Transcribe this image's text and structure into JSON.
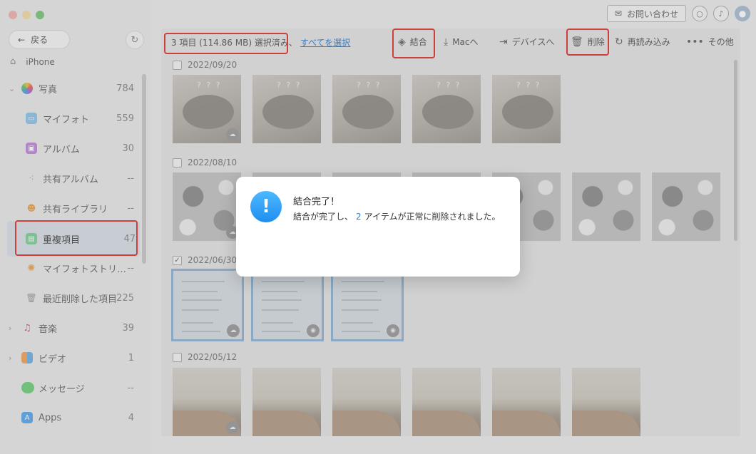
{
  "window": {
    "controls": [
      "close",
      "minimize",
      "maximize"
    ]
  },
  "sidebar": {
    "back_label": "戻る",
    "device_name": "iPhone",
    "items": [
      {
        "label": "写真",
        "count": "784",
        "expandable": true,
        "expanded": true,
        "icon": "photos-icon"
      },
      {
        "label": "マイフォト",
        "count": "559",
        "icon": "my-photos-icon"
      },
      {
        "label": "アルバム",
        "count": "30",
        "icon": "album-icon"
      },
      {
        "label": "共有アルバム",
        "count": "--",
        "icon": "shared-album-icon"
      },
      {
        "label": "共有ライブラリ",
        "count": "--",
        "icon": "shared-library-icon"
      },
      {
        "label": "重複項目",
        "count": "47",
        "icon": "duplicates-icon",
        "active": true
      },
      {
        "label": "マイフォトストリ…",
        "count": "--",
        "icon": "photo-stream-icon"
      },
      {
        "label": "最近削除した項目",
        "count": "225",
        "icon": "trash-icon"
      },
      {
        "label": "音楽",
        "count": "39",
        "expandable": true,
        "icon": "music-icon"
      },
      {
        "label": "ビデオ",
        "count": "1",
        "expandable": true,
        "icon": "video-icon"
      },
      {
        "label": "メッセージ",
        "count": "--",
        "icon": "messages-icon"
      },
      {
        "label": "Apps",
        "count": "4",
        "icon": "apps-icon"
      }
    ]
  },
  "topbar": {
    "contact_label": "お問い合わせ"
  },
  "toolbar": {
    "selection_info": "3 項目 (114.86 MB) 選択済み、",
    "select_all": "すべてを選択",
    "merge": "結合",
    "to_mac": "Macへ",
    "to_device": "デバイスへ",
    "delete": "削除",
    "reload": "再読み込み",
    "more": "その他"
  },
  "groups": [
    {
      "date": "2022/09/20",
      "checked": false,
      "count": 5,
      "kind": "cat"
    },
    {
      "date": "2022/08/10",
      "checked": false,
      "count": 7,
      "kind": "bear"
    },
    {
      "date": "2022/06/30",
      "checked": true,
      "count": 3,
      "kind": "shot"
    },
    {
      "date": "2022/05/12",
      "checked": false,
      "count": 6,
      "kind": "room"
    }
  ],
  "dialog": {
    "title": "結合完了！",
    "msg_pre": "結合が完了し、",
    "msg_num": "2",
    "msg_post": "アイテムが正常に削除されました。"
  },
  "colors": {
    "accent": "#2e7fd0",
    "highlight": "#e0322e",
    "dialog_icon": "#1f8ef0"
  }
}
